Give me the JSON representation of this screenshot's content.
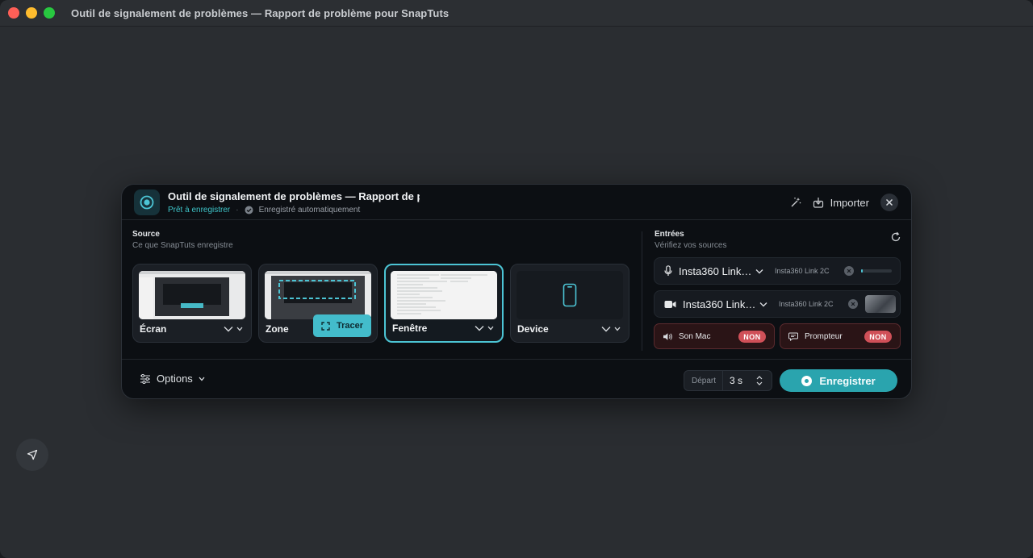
{
  "window": {
    "title": "Outil de signalement de problèmes — Rapport de problème pour SnapTuts"
  },
  "panel": {
    "title": "Outil de signalement de problèmes — Rapport de problème pour SnapTuts",
    "status_ready": "Prêt à enregistrer",
    "status_separator": "·",
    "status_saved": "Enregistré automatiquement",
    "import_label": "Importer"
  },
  "source": {
    "title": "Source",
    "subtitle": "Ce que SnapTuts enregistre",
    "cards": [
      {
        "label": "Écran",
        "selected": false
      },
      {
        "label": "Zone",
        "selected": false,
        "action": "Tracer"
      },
      {
        "label": "Fenêtre",
        "selected": true
      },
      {
        "label": "Device",
        "selected": false
      }
    ]
  },
  "inputs": {
    "title": "Entrées",
    "subtitle": "Vérifiez vos sources",
    "microphone": {
      "name": "Insta360 Link…",
      "device": "Insta360 Link 2C",
      "level": 0.05,
      "icon": "microphone-icon"
    },
    "camera": {
      "name": "Insta360 Link…",
      "device": "Insta360 Link 2C",
      "icon": "video-camera-icon"
    },
    "toggles": [
      {
        "label": "Son Mac",
        "state": "NON",
        "icon": "speaker-icon"
      },
      {
        "label": "Prompteur",
        "state": "NON",
        "icon": "speech-bubble-icon"
      }
    ]
  },
  "footer": {
    "options_label": "Options",
    "depart_label": "Départ",
    "depart_value": "3 s",
    "record_label": "Enregistrer"
  },
  "colors": {
    "accent": "#43bccb",
    "record": "#2aa4ae",
    "off_badge": "#d05058"
  }
}
